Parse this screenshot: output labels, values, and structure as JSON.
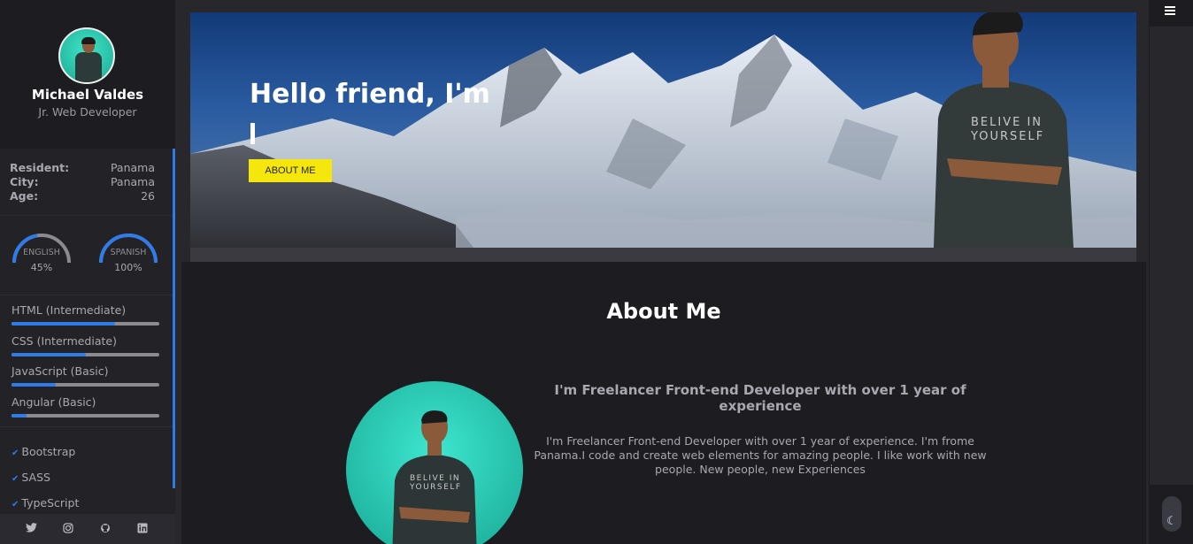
{
  "profile": {
    "name": "Michael Valdes",
    "role": "Jr. Web Developer"
  },
  "info": [
    {
      "label": "Resident:",
      "value": "Panama"
    },
    {
      "label": "City:",
      "value": "Panama"
    },
    {
      "label": "Age:",
      "value": "26"
    }
  ],
  "languages": [
    {
      "name": "ENGLISH",
      "percent_label": "45%",
      "level": 0.45
    },
    {
      "name": "SPANISH",
      "percent_label": "100%",
      "level": 1.0
    }
  ],
  "skills": [
    {
      "name": "HTML (Intermediate)",
      "level": 0.7
    },
    {
      "name": "CSS (Intermediate)",
      "level": 0.5
    },
    {
      "name": "JavaScript (Basic)",
      "level": 0.3
    },
    {
      "name": "Angular (Basic)",
      "level": 0.1
    }
  ],
  "tools": [
    "Bootstrap",
    "SASS",
    "TypeScript"
  ],
  "socials": [
    "twitter-icon",
    "instagram-icon",
    "github-icon",
    "linkedin-icon"
  ],
  "hero": {
    "title": "Hello friend, I'm",
    "button_label": "ABOUT ME"
  },
  "about": {
    "title": "About Me",
    "subtitle": "I'm Freelancer Front-end Developer with over 1 year of experience",
    "text": "I'm Freelancer Front-end Developer with over 1 year of experience. I'm frome Panama.I code and create web elements for amazing people. I like work with new people. New people, new Experiences"
  },
  "colors": {
    "accent": "#2f7be8",
    "button": "#f5e70b",
    "avatar_bg": "#3de6c8"
  },
  "icons": {
    "menu": "menu-icon",
    "theme": "moon-icon",
    "check": "check-icon"
  }
}
